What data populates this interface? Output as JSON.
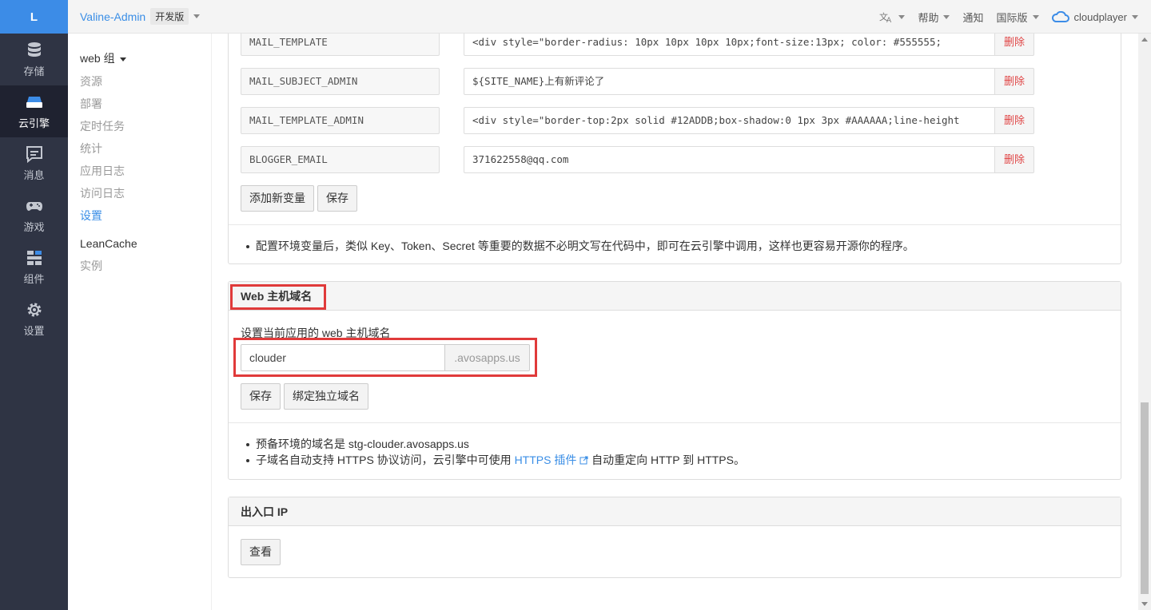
{
  "logo": "L",
  "leftnav": [
    {
      "label": "存储",
      "icon": "database-icon"
    },
    {
      "label": "云引擎",
      "icon": "cloud-engine-icon",
      "active": true
    },
    {
      "label": "消息",
      "icon": "message-icon"
    },
    {
      "label": "游戏",
      "icon": "gamepad-icon"
    },
    {
      "label": "组件",
      "icon": "components-icon"
    },
    {
      "label": "设置",
      "icon": "gear-icon"
    }
  ],
  "topbar": {
    "app_name": "Valine-Admin",
    "env": "开发版",
    "translate_icon": "translate-icon",
    "help": "帮助",
    "notify": "通知",
    "region": "国际版",
    "user": "cloudplayer"
  },
  "subnav": {
    "group1": "web 组",
    "items": [
      "资源",
      "部署",
      "定时任务",
      "统计",
      "应用日志",
      "访问日志",
      "设置"
    ],
    "group2": "LeanCache",
    "group2_items": [
      "实例"
    ]
  },
  "env_vars": [
    {
      "key": "MAIL_TEMPLATE",
      "value": "<div style=\"border-radius: 10px 10px 10px 10px;font-size:13px;    color: #555555;",
      "del": "删除"
    },
    {
      "key": "MAIL_SUBJECT_ADMIN",
      "value": "${SITE_NAME}上有新评论了",
      "del": "删除"
    },
    {
      "key": "MAIL_TEMPLATE_ADMIN",
      "value": "<div style=\"border-top:2px solid #12ADDB;box-shadow:0 1px 3px #AAAAAA;line-height",
      "del": "删除"
    },
    {
      "key": "BLOGGER_EMAIL",
      "value": "371622558@qq.com",
      "del": "删除"
    }
  ],
  "env_buttons": {
    "add": "添加新变量",
    "save": "保存"
  },
  "env_note": "配置环境变量后，类似 Key、Token、Secret 等重要的数据不必明文写在代码中，即可在云引擎中调用，这样也更容易开源你的程序。",
  "web_domain": {
    "title": "Web 主机域名",
    "desc": "设置当前应用的 web 主机域名",
    "value": "clouder",
    "suffix": ".avosapps.us",
    "save": "保存",
    "bind": "绑定独立域名",
    "note1": "预备环境的域名是 stg-clouder.avosapps.us",
    "note2_a": "子域名自动支持 HTTPS 协议访问，云引擎中可使用",
    "note2_link": "HTTPS 插件",
    "note2_b": "自动重定向 HTTP 到 HTTPS。"
  },
  "outbound_ip": {
    "title": "出入口 IP",
    "view": "查看"
  }
}
